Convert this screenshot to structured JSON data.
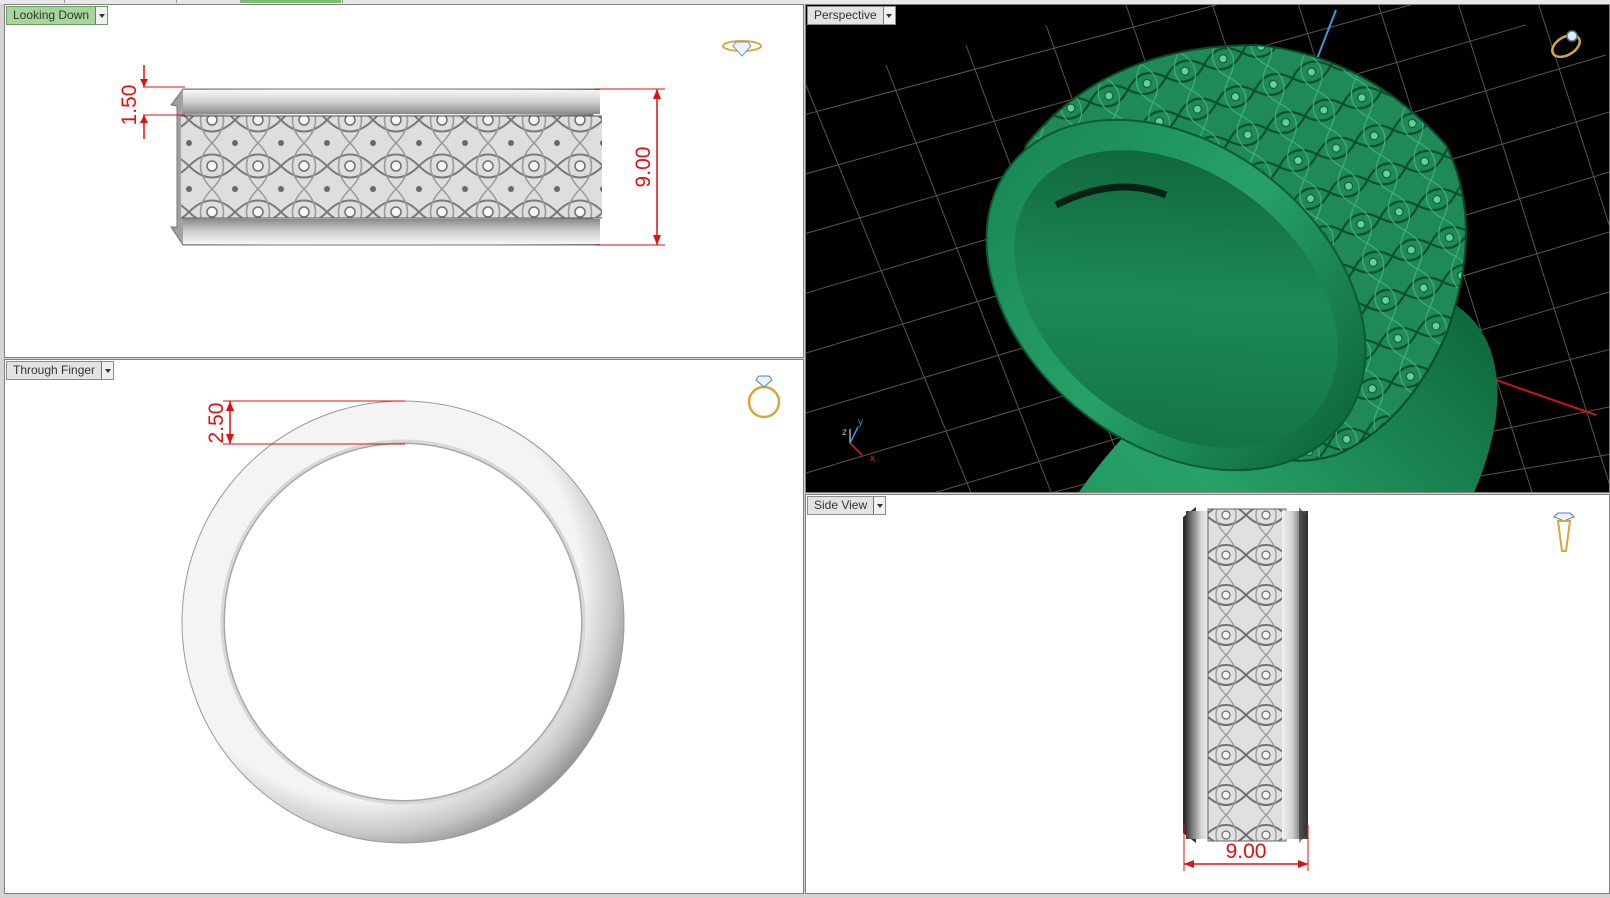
{
  "viewports": {
    "top_left": {
      "label": "Looking Down",
      "active": true
    },
    "top_right": {
      "label": "Perspective",
      "active": false
    },
    "bottom_left": {
      "label": "Through Finger",
      "active": false
    },
    "bottom_right": {
      "label": "Side View",
      "active": false
    }
  },
  "dimensions": {
    "shoulder_height": "1.50",
    "band_width": "9.00",
    "band_thickness": "2.50",
    "side_width": "9.00"
  },
  "axis_gizmo": {
    "z": "z",
    "y": "y",
    "x": "x"
  },
  "icons": {
    "top_view_icon": "ring-top-view-icon",
    "perspective_icon": "ring-perspective-icon",
    "front_icon": "ring-front-view-icon",
    "side_icon": "ring-side-view-icon"
  },
  "colors": {
    "active_tab": "#a8d59b",
    "render_green": "#1a7a4d",
    "dimension_red": "#d11111",
    "grid_background": "#000000"
  }
}
